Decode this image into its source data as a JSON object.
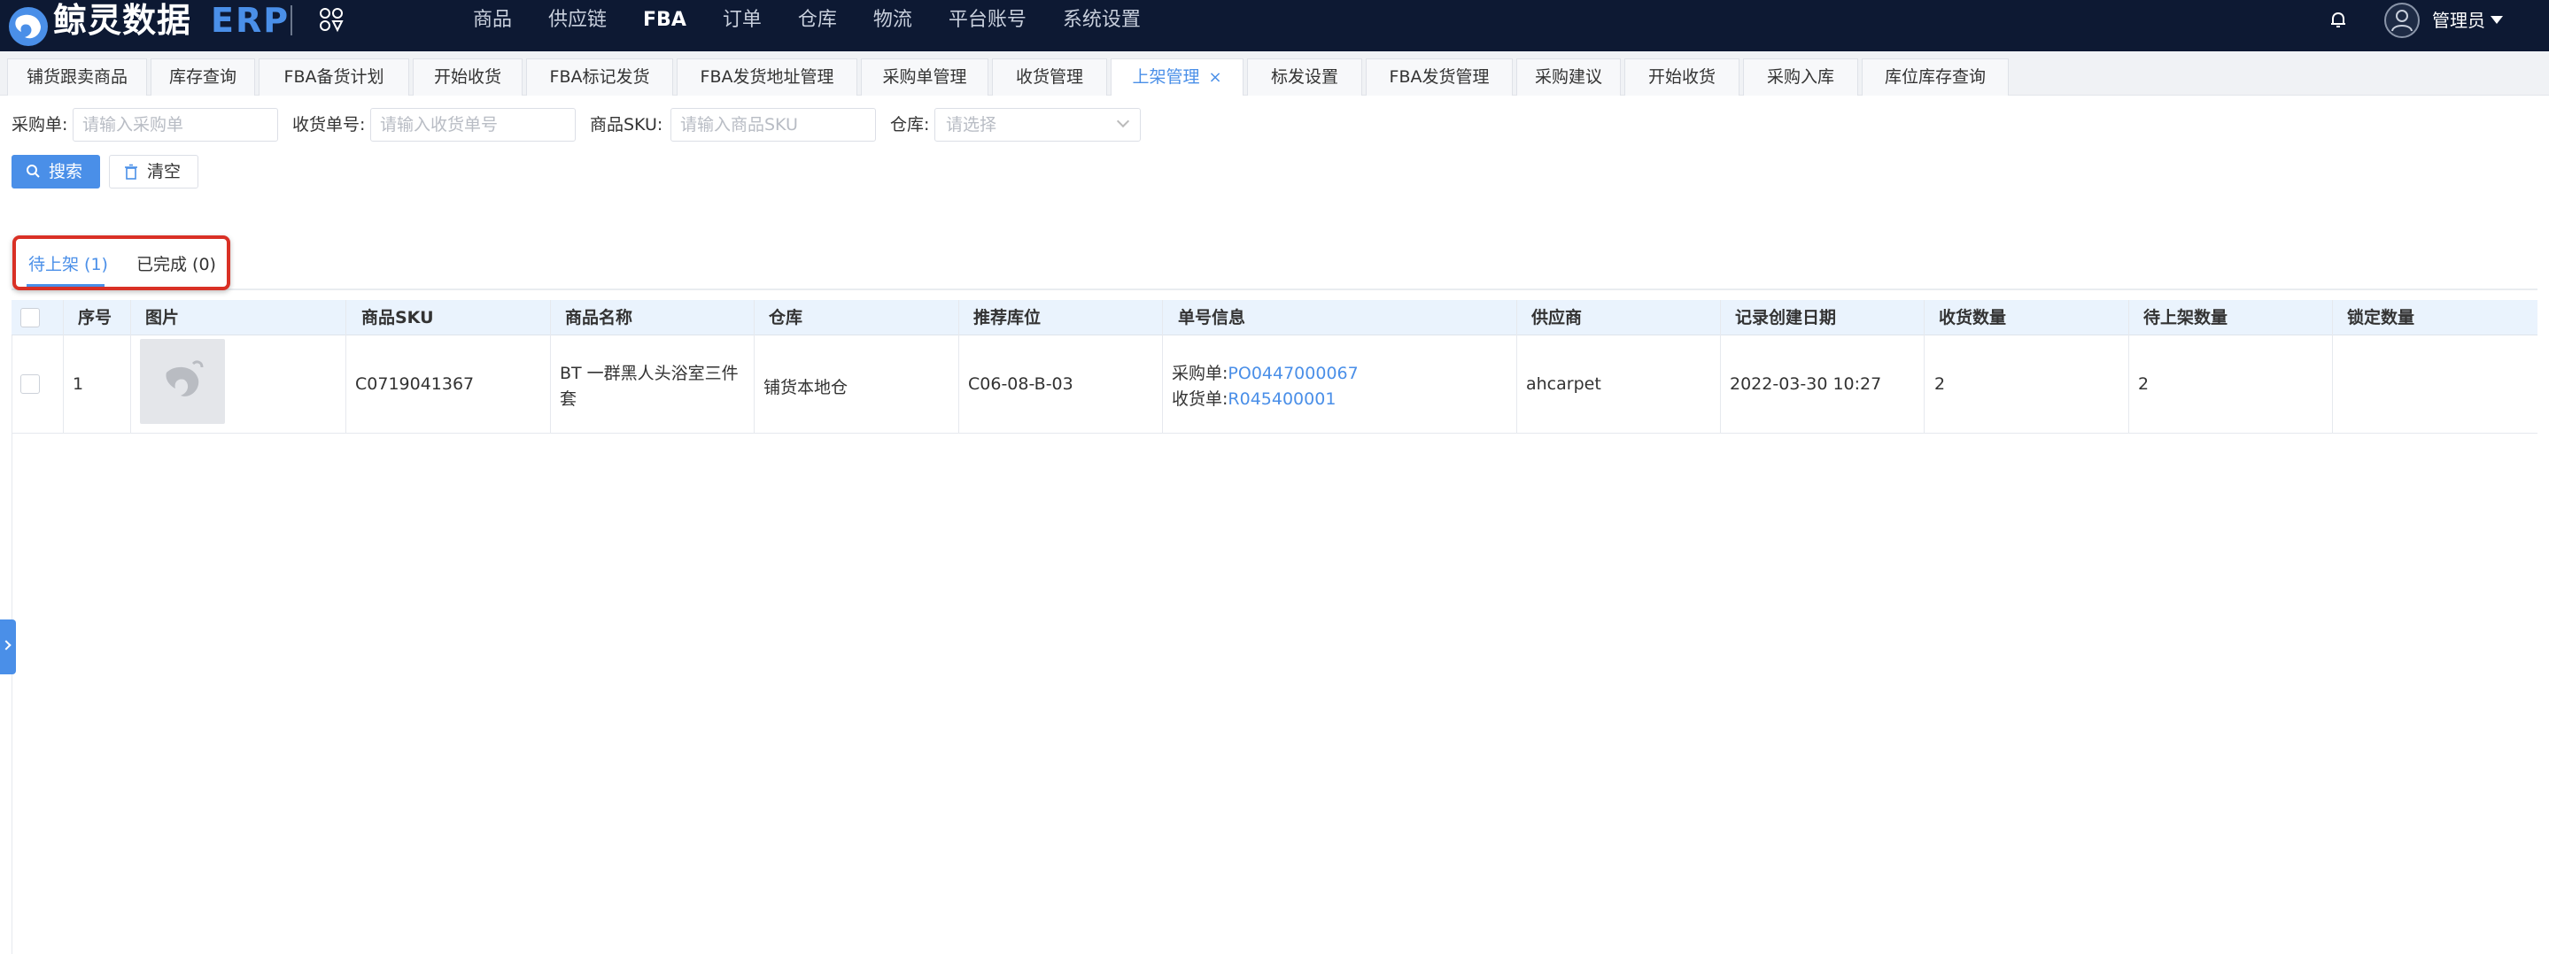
{
  "header": {
    "logo_text": "鲸灵数据",
    "logo_erp": "ERP",
    "nav": [
      "商品",
      "供应链",
      "FBA",
      "订单",
      "仓库",
      "物流",
      "平台账号",
      "系统设置"
    ],
    "nav_active": "FBA",
    "user_name": "管理员"
  },
  "tabs": [
    "铺货跟卖商品",
    "库存查询",
    "FBA备货计划",
    "开始收货",
    "FBA标记发货",
    "FBA发货地址管理",
    "采购单管理",
    "收货管理",
    "上架管理",
    "标发设置",
    "FBA发货管理",
    "采购建议",
    "开始收货",
    "采购入库",
    "库位库存查询"
  ],
  "active_tab": "上架管理",
  "filters": {
    "po_label": "采购单:",
    "po_placeholder": "请输入采购单",
    "receipt_label": "收货单号:",
    "receipt_placeholder": "请输入收货单号",
    "sku_label": "商品SKU:",
    "sku_placeholder": "请输入商品SKU",
    "warehouse_label": "仓库:",
    "warehouse_placeholder": "请选择"
  },
  "buttons": {
    "search": "搜索",
    "clear": "清空"
  },
  "status_tabs": [
    {
      "label": "待上架 (1)",
      "active": true
    },
    {
      "label": "已完成 (0)",
      "active": false
    }
  ],
  "table": {
    "columns": [
      "序号",
      "图片",
      "商品SKU",
      "商品名称",
      "仓库",
      "推荐库位",
      "单号信息",
      "供应商",
      "记录创建日期",
      "收货数量",
      "待上架数量",
      "锁定数量"
    ],
    "rows": [
      {
        "index": "1",
        "sku": "C0719041367",
        "name_line1": "BT 一群黑人头浴室三件",
        "name_line2": "套",
        "warehouse": "铺货本地仓",
        "location": "C06-08-B-03",
        "po_label": "采购单:",
        "po_number": "PO0447000067",
        "receipt_label": "收货单:",
        "receipt_number": "R045400001",
        "supplier": "ahcarpet",
        "created": "2022-03-30 10:27",
        "received_qty": "2",
        "pending_qty": "2",
        "locked_qty": ""
      }
    ]
  },
  "colors": {
    "header_bg": "#0d1933",
    "accent": "#4a8fe8",
    "highlight_box": "#d93025",
    "table_header_bg": "#eaf3fd"
  },
  "icons": [
    "logo-whale-icon",
    "apps-icon",
    "bell-icon",
    "user-avatar-icon",
    "search-icon",
    "trash-icon",
    "chevron-down-icon",
    "close-icon",
    "chevron-right-icon"
  ]
}
